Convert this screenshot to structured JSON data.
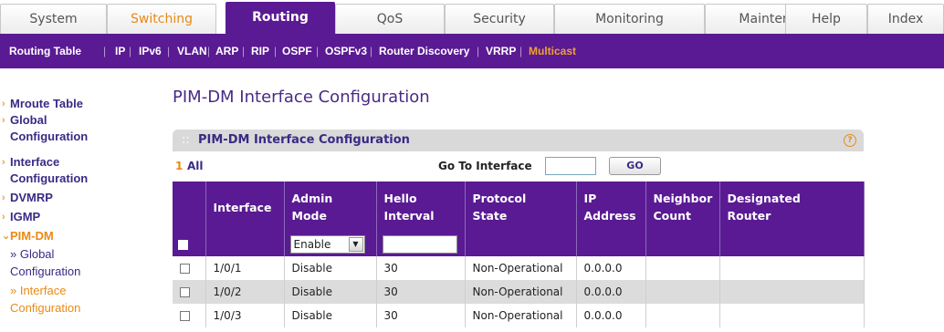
{
  "main_tabs": [
    {
      "label": "System",
      "state": "normal"
    },
    {
      "label": "Switching",
      "state": "orange"
    },
    {
      "label": "Routing",
      "state": "active"
    },
    {
      "label": "QoS",
      "state": "normal"
    },
    {
      "label": "Security",
      "state": "normal"
    },
    {
      "label": "Monitoring",
      "state": "normal"
    },
    {
      "label": "Maintenance",
      "state": "normal"
    },
    {
      "label": "Help",
      "state": "normal"
    },
    {
      "label": "Index",
      "state": "normal"
    }
  ],
  "sub_nav": [
    {
      "label": "Routing Table"
    },
    {
      "label": "IP"
    },
    {
      "label": "IPv6"
    },
    {
      "label": "VLAN"
    },
    {
      "label": "ARP"
    },
    {
      "label": "RIP"
    },
    {
      "label": "OSPF"
    },
    {
      "label": "OSPFv3"
    },
    {
      "label": "Router Discovery"
    },
    {
      "label": "VRRP"
    },
    {
      "label": "Multicast",
      "active": true
    }
  ],
  "sidebar": {
    "items": [
      {
        "label": "Mroute Table"
      },
      {
        "label1": "Global",
        "label2": "Configuration"
      },
      {
        "label1": "Interface",
        "label2": "Configuration"
      },
      {
        "label": "DVMRP"
      },
      {
        "label": "IGMP"
      },
      {
        "label": "PIM-DM"
      }
    ],
    "subitems": [
      {
        "label1": "» Global",
        "label2": "Configuration"
      },
      {
        "label1": "» Interface",
        "label2": "Configuration"
      }
    ]
  },
  "page_title": "PIM-DM Interface Configuration",
  "panel": {
    "title": "PIM-DM Interface Configuration",
    "help_icon": "?",
    "page_number": "1",
    "all_label": "All",
    "goto_label": "Go To Interface",
    "goto_value": "",
    "go_button": "GO"
  },
  "table": {
    "headers": [
      {
        "l1": "Interface",
        "l2": ""
      },
      {
        "l1": "Admin",
        "l2": "Mode"
      },
      {
        "l1": "Hello",
        "l2": "Interval"
      },
      {
        "l1": "Protocol",
        "l2": "State"
      },
      {
        "l1": "IP",
        "l2": "Address"
      },
      {
        "l1": "Neighbor",
        "l2": "Count"
      },
      {
        "l1": "Designated",
        "l2": "Router"
      }
    ],
    "filter": {
      "admin_mode": "Enable",
      "hello_interval": ""
    },
    "rows": [
      {
        "interface": "1/0/1",
        "admin_mode": "Disable",
        "hello_interval": "30",
        "protocol_state": "Non-Operational",
        "ip_address": "0.0.0.0",
        "neighbor_count": "",
        "designated_router": ""
      },
      {
        "interface": "1/0/2",
        "admin_mode": "Disable",
        "hello_interval": "30",
        "protocol_state": "Non-Operational",
        "ip_address": "0.0.0.0",
        "neighbor_count": "",
        "designated_router": ""
      },
      {
        "interface": "1/0/3",
        "admin_mode": "Disable",
        "hello_interval": "30",
        "protocol_state": "Non-Operational",
        "ip_address": "0.0.0.0",
        "neighbor_count": "",
        "designated_router": ""
      }
    ]
  },
  "colors": {
    "brand_purple": "#5a1a93",
    "accent_orange": "#e98a16"
  }
}
